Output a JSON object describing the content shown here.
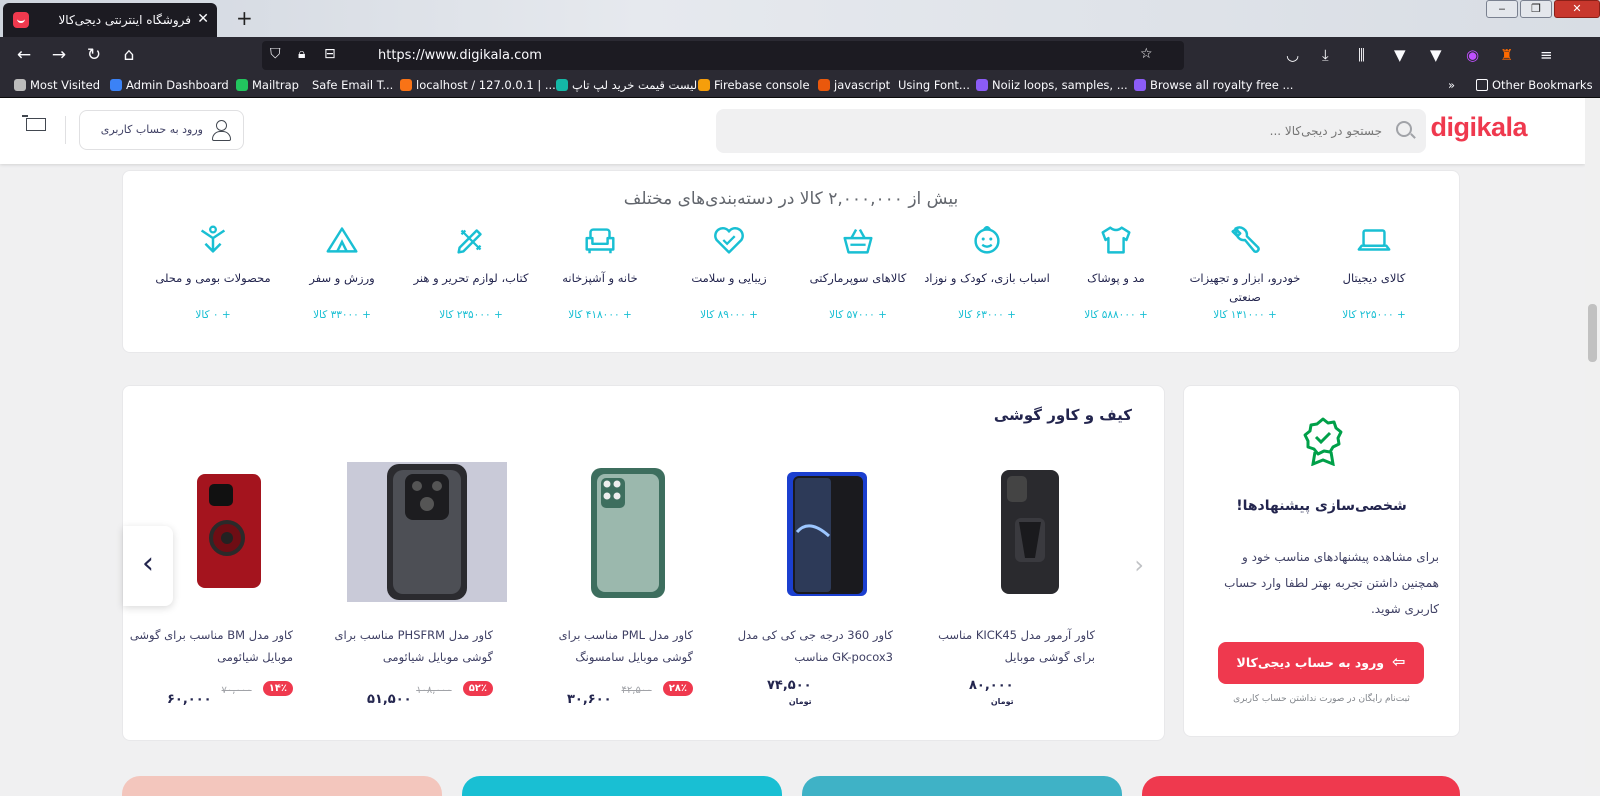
{
  "browser": {
    "tab_title": "فروشگاه اینترنتی دیجی‌کالا",
    "url": "https://www.digikala.com",
    "bookmarks": [
      "Most Visited",
      "Admin Dashboard",
      "Mailtrap",
      "Safe Email T...",
      "localhost / 127.0.0.1 | ...",
      "لیست قیمت خرید لپ تاپ",
      "Firebase console",
      "javascript",
      "Using Font...",
      "Noiiz loops, samples, ...",
      "Browse all royalty free ...",
      "Other Bookmarks"
    ]
  },
  "header": {
    "logo": "digikala",
    "search_placeholder": "جستجو در دیجی‌کالا ...",
    "login_label": "ورود به حساب کاربری"
  },
  "categories": {
    "title": "بیش از ۲,۰۰۰,۰۰۰ کالا در دسته‌بندی‌های مختلف",
    "items": [
      {
        "name": "کالای دیجیتال",
        "count": "+ ۲۲۵۰۰۰ کالا",
        "icon": "laptop-icon"
      },
      {
        "name": "خودرو، ابزار و تجهیزات صنعتی",
        "count": "+ ۱۳۱۰۰۰ کالا",
        "icon": "wrench-icon"
      },
      {
        "name": "مد و پوشاک",
        "count": "+ ۵۸۸۰۰۰ کالا",
        "icon": "shirt-icon"
      },
      {
        "name": "اسباب بازی، کودک و نوزاد",
        "count": "+ ۶۳۰۰۰ کالا",
        "icon": "baby-icon"
      },
      {
        "name": "کالاهای سوپرمارکتی",
        "count": "+ ۵۷۰۰۰ کالا",
        "icon": "basket-icon"
      },
      {
        "name": "زیبایی و سلامت",
        "count": "+ ۸۹۰۰۰ کالا",
        "icon": "heart-icon"
      },
      {
        "name": "خانه و آشپزخانه",
        "count": "+ ۴۱۸۰۰۰ کالا",
        "icon": "sofa-icon"
      },
      {
        "name": "کتاب، لوازم تحریر و هنر",
        "count": "+ ۲۳۵۰۰۰ کالا",
        "icon": "pencil-ruler-icon"
      },
      {
        "name": "ورزش و سفر",
        "count": "+ ۳۳۰۰۰ کالا",
        "icon": "tent-icon"
      },
      {
        "name": "محصولات بومی و محلی",
        "count": "+ ۰ کالا",
        "icon": "local-products-icon"
      }
    ]
  },
  "products": {
    "title": "کیف و کاور گوشی",
    "currency": "تومان",
    "items": [
      {
        "name": "کاور آرمور مدل KICK45 مناسب برای گوشی موبایل",
        "price": "۸۰,۰۰۰",
        "old": "",
        "discount": ""
      },
      {
        "name": "کاور 360 درجه جی کی کی مدل GK-pocox3 مناسب",
        "price": "۷۴,۵۰۰",
        "old": "",
        "discount": ""
      },
      {
        "name": "کاور مدل PML مناسب برای گوشی موبایل سامسونگ",
        "price": "۳۰,۶۰۰",
        "old": "۴۲,۵۰۰",
        "discount": "۲۸٪"
      },
      {
        "name": "کاور مدل PHSFRM مناسب برای گوشی موبایل شیائومی",
        "price": "۵۱,۵۰۰",
        "old": "۱۰۸,۰۰۰",
        "discount": "۵۲٪"
      },
      {
        "name": "کاور مدل BM مناسب برای گوشی موبایل شیائومی",
        "price": "۶۰,۰۰۰",
        "old": "۷۰,۰۰۰",
        "discount": "۱۴٪"
      }
    ]
  },
  "personalize": {
    "title": "شخصی‌سازی پیشنهادها!",
    "text": "برای مشاهده پیشنهادهای مناسب خود و همچنین داشتن تجربه بهتر لطفا وارد حساب کاربری شوید.",
    "button": "ورود به حساب دیجی‌کالا",
    "note": "ثبت‌نام رایگان در صورت نداشتن حساب کاربری"
  },
  "colors": {
    "brand": "#ef394e",
    "accent": "#19bfd3"
  }
}
